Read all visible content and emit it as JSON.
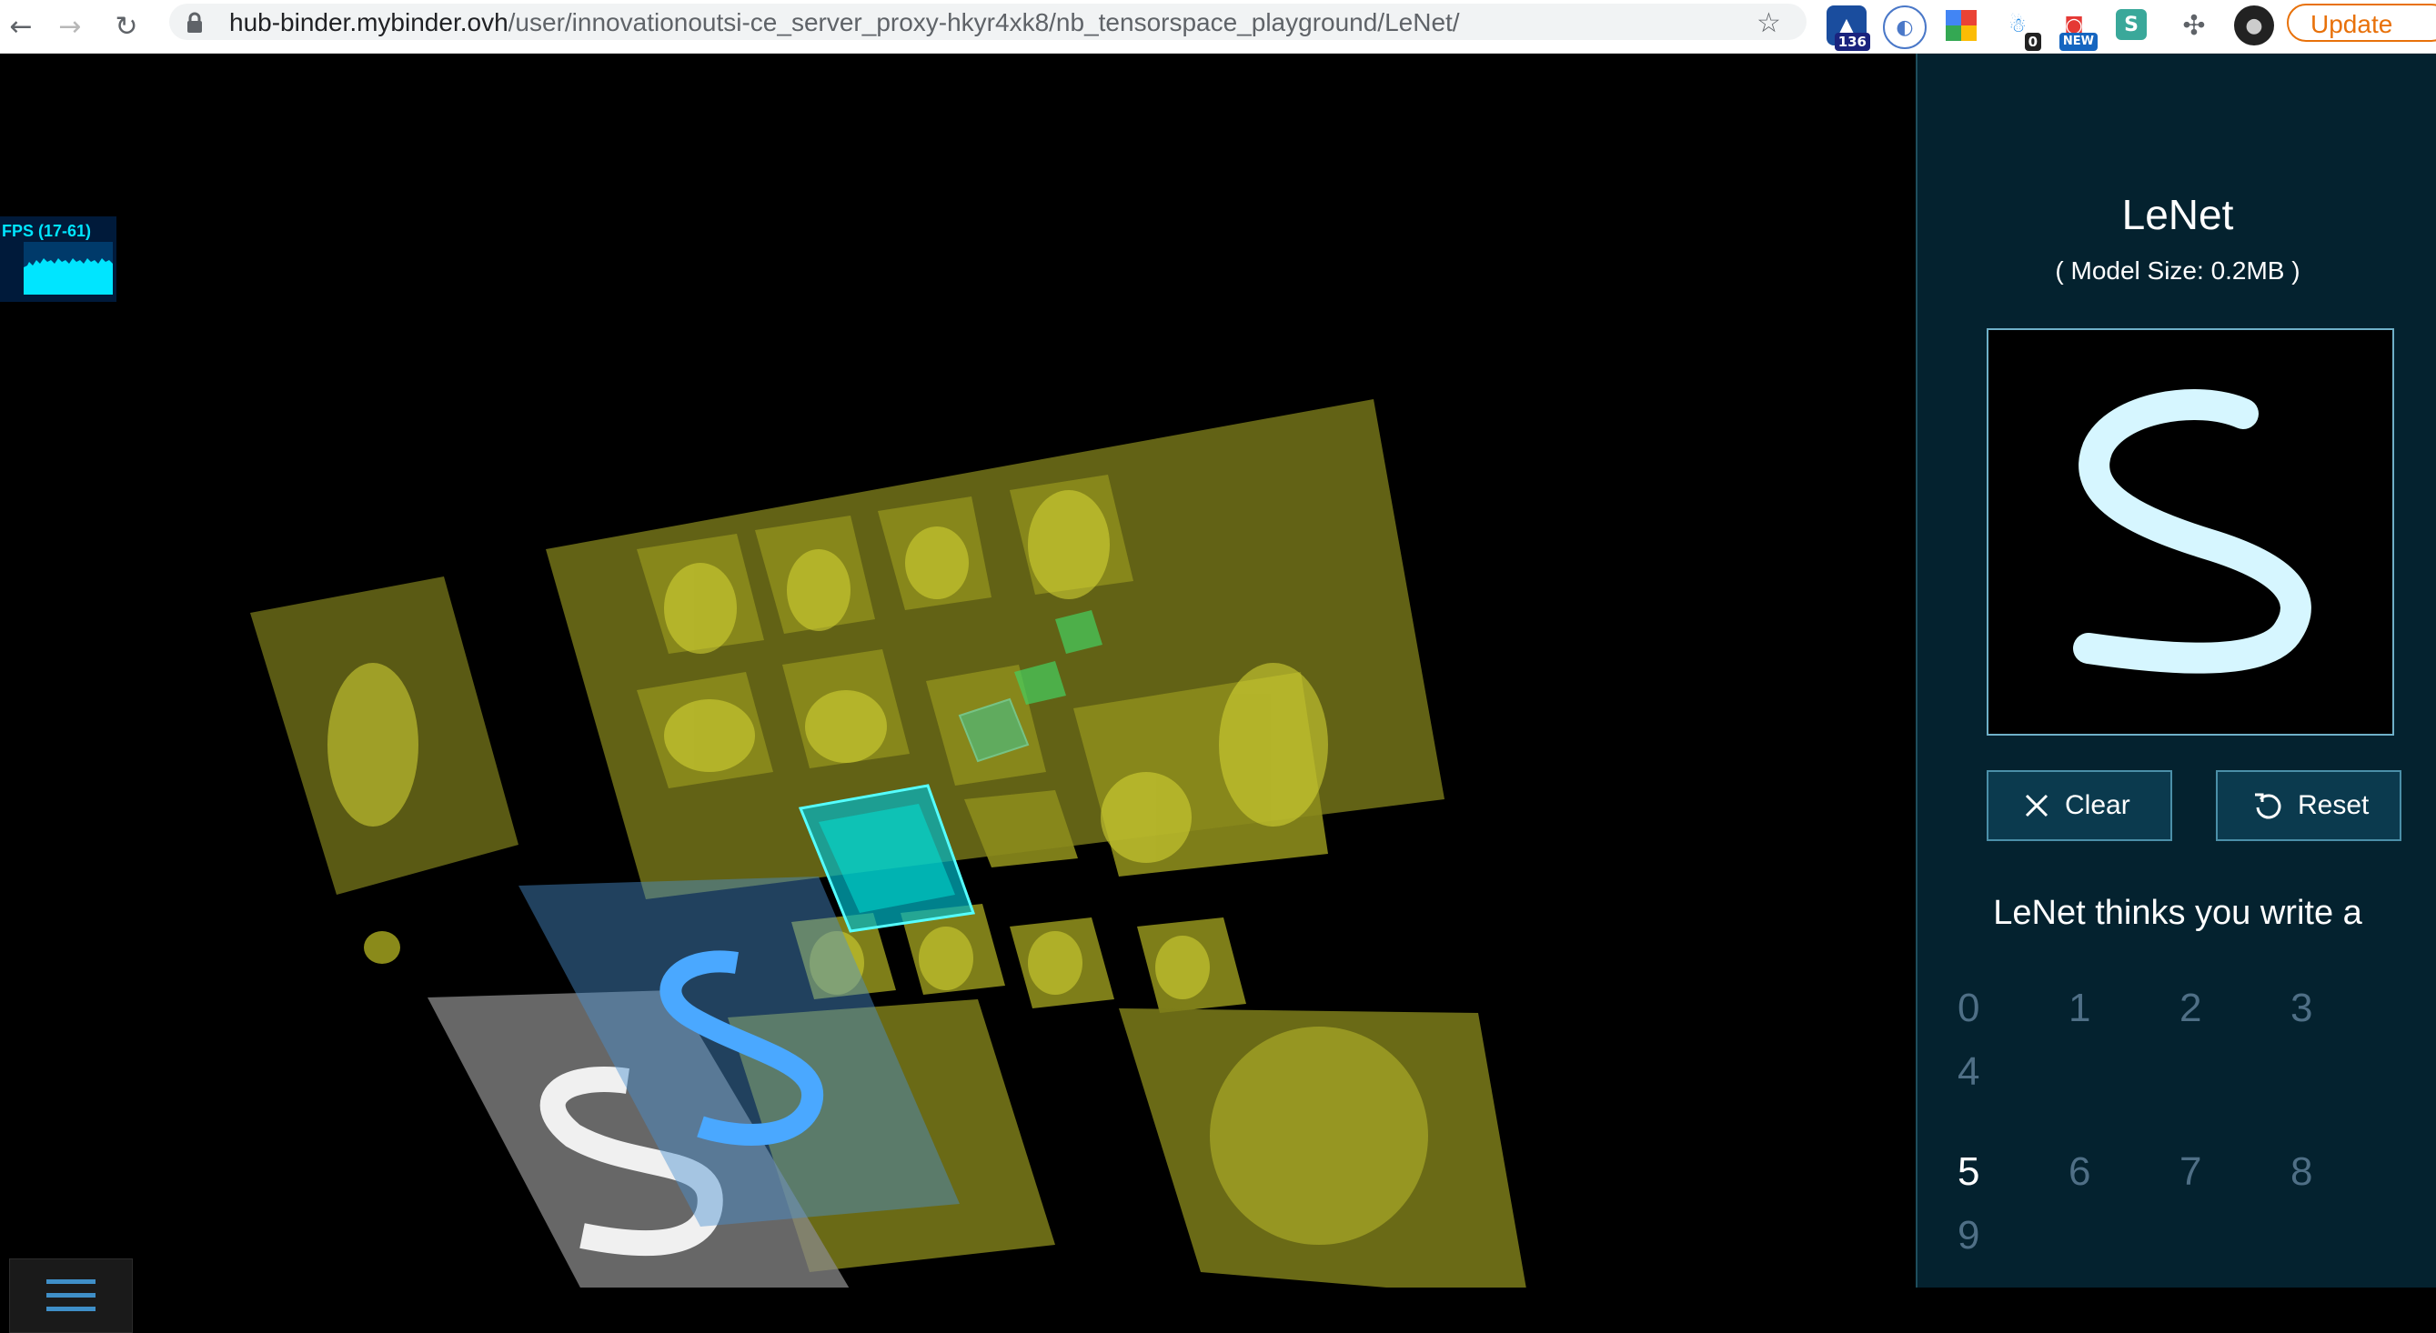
{
  "browser": {
    "url_host": "hub-binder.mybinder.ovh",
    "url_path": "/user/innovationoutsi-ce_server_proxy-hkyr4xk8/nb_tensorspace_playground/LeNet/",
    "back_icon": "arrow-left-icon",
    "forward_icon": "arrow-right-icon",
    "reload_icon": "reload-icon",
    "extensions": [
      {
        "name": "extension-1",
        "badge": "136",
        "color": "#1a4d9e",
        "badge_color": "#1a237e"
      },
      {
        "name": "extension-2",
        "badge": "",
        "color": "#4a78c8",
        "badge_color": ""
      },
      {
        "name": "extension-3",
        "badge": "",
        "color": "#34a853",
        "badge_color": ""
      },
      {
        "name": "extension-4",
        "badge": "0",
        "color": "#1e88e5",
        "badge_color": "#222222"
      },
      {
        "name": "extension-5",
        "badge": "NEW",
        "color": "#e53935",
        "badge_color": "#1565c0"
      },
      {
        "name": "extension-6",
        "badge": "",
        "color": "#3aa89a",
        "badge_color": ""
      }
    ],
    "update_label": "Update"
  },
  "fps": {
    "label": "FPS (17-61)"
  },
  "panel": {
    "title": "LeNet",
    "model_size": "( Model Size: 0.2MB )",
    "clear_label": "Clear",
    "reset_label": "Reset",
    "prediction_heading": "LeNet thinks you write a",
    "digits": [
      "0",
      "1",
      "2",
      "3",
      "4",
      "5",
      "6",
      "7",
      "8",
      "9"
    ],
    "predicted_digit": "5"
  },
  "colors": {
    "panel_bg": "#04222f",
    "feature_map": "#8a8a1e",
    "accent_cyan": "#00e5ff",
    "update_orange": "#e8710a"
  }
}
